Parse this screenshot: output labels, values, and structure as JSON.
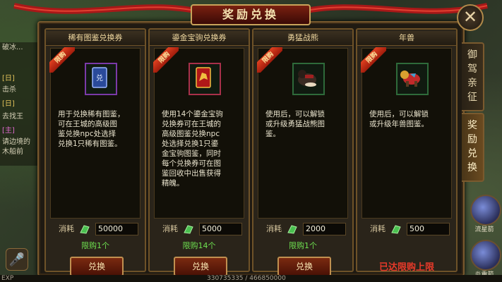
{
  "title": "奖励兑换",
  "chat": {
    "lines": [
      {
        "tag": "",
        "text": "破冰..."
      },
      {
        "tag": "[日]",
        "text": ""
      },
      {
        "tag": "",
        "text": "击杀"
      },
      {
        "tag": "[日]",
        "text": ""
      },
      {
        "tag": "",
        "text": "去找王"
      },
      {
        "tag": "[主]",
        "text": ""
      },
      {
        "tag": "",
        "text": "请边境的"
      },
      {
        "tag": "",
        "text": "木船前"
      }
    ]
  },
  "exp": {
    "label": "EXP",
    "value": "330735335 / 466850000"
  },
  "side_tabs": [
    {
      "label": "御驾亲征",
      "active": false
    },
    {
      "label": "奖励兑换",
      "active": true
    }
  ],
  "skills": [
    {
      "label": "流星箭"
    },
    {
      "label": "炎重箭"
    }
  ],
  "cost_label": "消耗",
  "limit_tag": "限购",
  "cards": [
    {
      "title": "稀有图鉴兑换券",
      "icon": "rare-card-icon",
      "frame": "purple",
      "desc": "用于兑换稀有图鉴，\n可在王城的高级图\n鉴兑换npc处选择\n兑换1只稀有图鉴。",
      "cost": "50000",
      "quota": "限购1个",
      "button": "兑换",
      "reached": ""
    },
    {
      "title": "鎏金宝驹兑换券",
      "icon": "gold-horse-card-icon",
      "frame": "red",
      "desc": "使用14个鎏金宝驹\n兑换券可在王城的\n高级图鉴兑换npc\n处选择兑换1只鎏\n金宝驹图鉴，同时\n每个兑换券可在图\n鉴回收中出售获得\n精魄。",
      "cost": "5000",
      "quota": "限购14个",
      "button": "兑换",
      "reached": ""
    },
    {
      "title": "勇猛战熊",
      "icon": "war-bear-icon",
      "frame": "green",
      "desc": "使用后，可以解锁\n或升级勇猛战熊图\n鉴。",
      "cost": "2000",
      "quota": "限购1个",
      "button": "兑换",
      "reached": ""
    },
    {
      "title": "年兽",
      "icon": "nian-beast-icon",
      "frame": "green",
      "desc": "使用后，可以解锁\n或升级年兽图鉴。",
      "cost": "500",
      "quota": "",
      "button": "",
      "reached": "已达限购上限"
    }
  ],
  "colors": {
    "accent": "#c9a35a",
    "quota": "#6ee050",
    "reached": "#e83a2a",
    "limit": "#e04020"
  }
}
